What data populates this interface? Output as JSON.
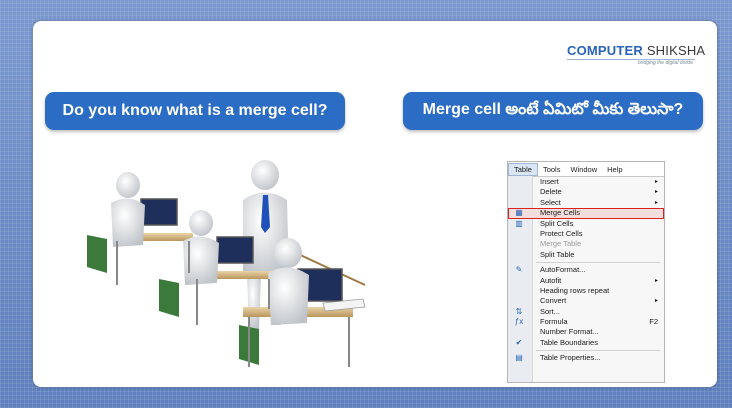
{
  "logo": {
    "brand_primary": "COMPUTER",
    "brand_secondary": "SHIKSHA",
    "tagline": "bridging the digital divide"
  },
  "left_heading": "Do you know what is a merge cell?",
  "right_heading": "Merge cell అంటే ఏమిటో మీకు తెలుసా?",
  "menu": {
    "bar": [
      "Table",
      "Tools",
      "Window",
      "Help"
    ],
    "groups": [
      [
        {
          "label": "Insert",
          "arrow": "▸",
          "icon": ""
        },
        {
          "label": "Delete",
          "arrow": "▸",
          "icon": ""
        },
        {
          "label": "Select",
          "arrow": "▸",
          "icon": ""
        },
        {
          "label": "Merge Cells",
          "icon": "merge-cells-icon",
          "glyph": "▦",
          "highlight": true
        },
        {
          "label": "Split Cells",
          "icon": "split-cells-icon",
          "glyph": "▥"
        },
        {
          "label": "Protect Cells",
          "icon": ""
        },
        {
          "label": "Merge Table",
          "icon": "",
          "disabled": true
        },
        {
          "label": "Split Table",
          "icon": ""
        }
      ],
      [
        {
          "label": "AutoFormat...",
          "icon": "autoformat-icon",
          "glyph": "✎"
        },
        {
          "label": "Autofit",
          "arrow": "▸",
          "icon": ""
        },
        {
          "label": "Heading rows repeat",
          "icon": ""
        },
        {
          "label": "Convert",
          "arrow": "▸",
          "icon": ""
        },
        {
          "label": "Sort...",
          "icon": "sort-icon",
          "glyph": "⇅"
        },
        {
          "label": "Formula",
          "key": "F2",
          "icon": "formula-icon",
          "glyph": "ƒx"
        },
        {
          "label": "Number Format...",
          "icon": ""
        },
        {
          "label": "Table Boundaries",
          "icon": "checkmark-icon",
          "glyph": "✔"
        }
      ],
      [
        {
          "label": "Table Properties...",
          "icon": "table-properties-icon",
          "glyph": "▤"
        }
      ]
    ]
  }
}
